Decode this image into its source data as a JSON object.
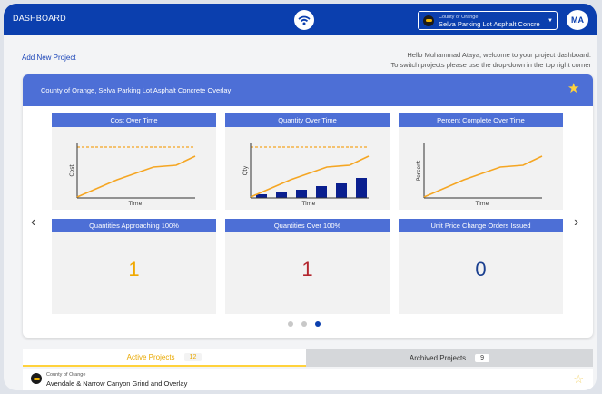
{
  "topbar": {
    "title": "DASHBOARD",
    "avatar_initials": "MA"
  },
  "project_selector": {
    "org": "County of Orange",
    "project": "Selva Parking Lot Asphalt Concre"
  },
  "actions": {
    "add_project": "Add New Project"
  },
  "welcome": {
    "line1": "Hello Muhammad Ataya, welcome to your project dashboard.",
    "line2": "To switch projects please use the drop-down in the top right corner"
  },
  "project_card": {
    "title": "County of Orange, Selva Parking Lot Asphalt Concrete Overlay"
  },
  "panels": {
    "cost": {
      "title": "Cost Over Time",
      "ylabel": "Cost",
      "xlabel": "Time"
    },
    "qty": {
      "title": "Quantity Over Time",
      "ylabel": "Qty",
      "xlabel": "Time"
    },
    "pct": {
      "title": "Percent Complete Over Time",
      "ylabel": "Percent",
      "xlabel": "Time"
    },
    "approaching": {
      "title": "Quantities Approaching 100%",
      "value": "1"
    },
    "over": {
      "title": "Quantities Over 100%",
      "value": "1"
    },
    "change_orders": {
      "title": "Unit Price Change Orders Issued",
      "value": "0"
    }
  },
  "carousel": {
    "prev": "‹",
    "next": "›",
    "pages": 3,
    "active_index": 2
  },
  "tabs": {
    "active_label": "Active Projects",
    "active_count": "12",
    "archived_label": "Archived Projects",
    "archived_count": "9"
  },
  "project_list": [
    {
      "org": "County of Orange",
      "name": "Avendale & Narrow Canyon Grind and Overlay"
    }
  ],
  "colors": {
    "primary": "#0b3fae",
    "panel_header": "#4d6fd6",
    "accent_orange": "#f5a623",
    "bar_navy": "#0a1f8f",
    "num_orange": "#f0a800",
    "num_red": "#b3262e",
    "num_blue": "#1a3f8f"
  }
}
